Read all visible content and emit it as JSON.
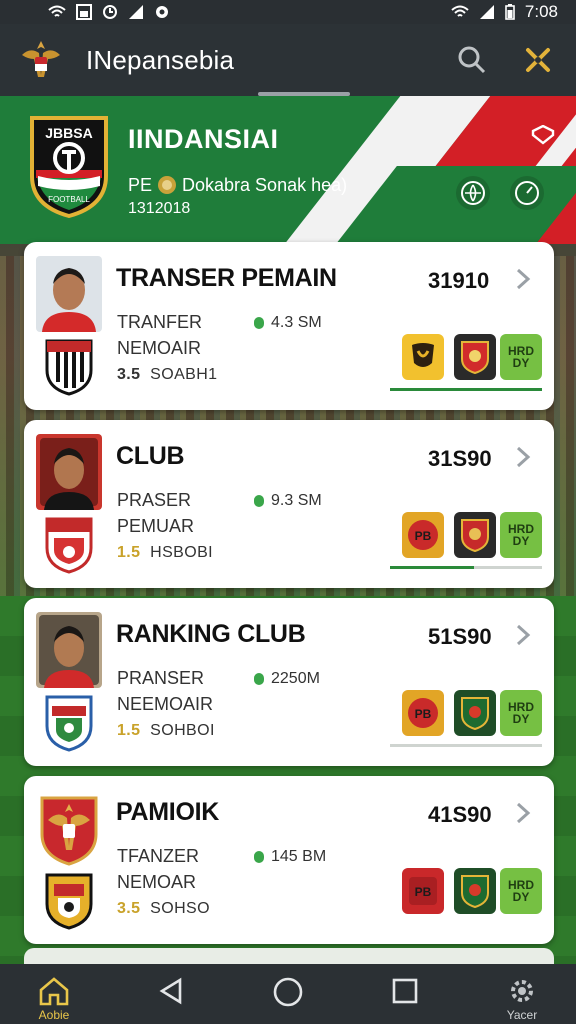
{
  "status_bar": {
    "time": "7:08",
    "icons": [
      "wifi-icon",
      "image-icon",
      "alarm-icon",
      "signal-icon",
      "settings-dot-icon",
      "wifi-icon",
      "signal-icon",
      "battery-icon"
    ]
  },
  "app_bar": {
    "title": "INepansebia",
    "icons": [
      "garuda-logo-icon",
      "search-icon",
      "share-icon"
    ]
  },
  "hero": {
    "crest_text": "JBBSA",
    "crest_bottom": "FOOTBALL",
    "country": "IINDANSIAI",
    "subline_prefix": "PE",
    "subline": "Dokabra Sonak hea)",
    "code": "1312018",
    "colors": {
      "green": "#1f7d3a",
      "red": "#d31f26",
      "white": "#f2f2f2"
    }
  },
  "cards": [
    {
      "title": "TRANSER PEMAIN",
      "value": "31910",
      "line1": "TRANFER",
      "line2": "NEMOAIR",
      "line3_num": "3.5",
      "line3_text": "SOABH1",
      "fee": "4.3 SM",
      "mini_label": "HRD DY",
      "progress": 1.0
    },
    {
      "title": "CLUB",
      "value": "31S90",
      "line1": "PRASER",
      "line2": "PEMUAR",
      "line3_num": "1.5",
      "line3_text": "HSBOBI",
      "fee": "9.3 SM",
      "mini_label": "HRD DY",
      "progress": 0.55
    },
    {
      "title": "RANKING CLUB",
      "value": "51S90",
      "line1": "PRANSER",
      "line2": "NEEMOAIR",
      "line3_num": "1.5",
      "line3_text": "SOHBOI",
      "fee": "2250M",
      "mini_label": "HRD DY",
      "progress": 0.0
    },
    {
      "title": "PAMIOIK",
      "value": "41S90",
      "line1": "TFANZER",
      "line2": "NEMOAR",
      "line3_num": "3.5",
      "line3_text": "SOHSO",
      "fee": "145 BM",
      "mini_label": "HRD DY",
      "progress": 0.0
    }
  ],
  "bottom_nav": {
    "home_label": "Aobie",
    "settings_label": "Yacer",
    "accent": "#e9c64a"
  }
}
